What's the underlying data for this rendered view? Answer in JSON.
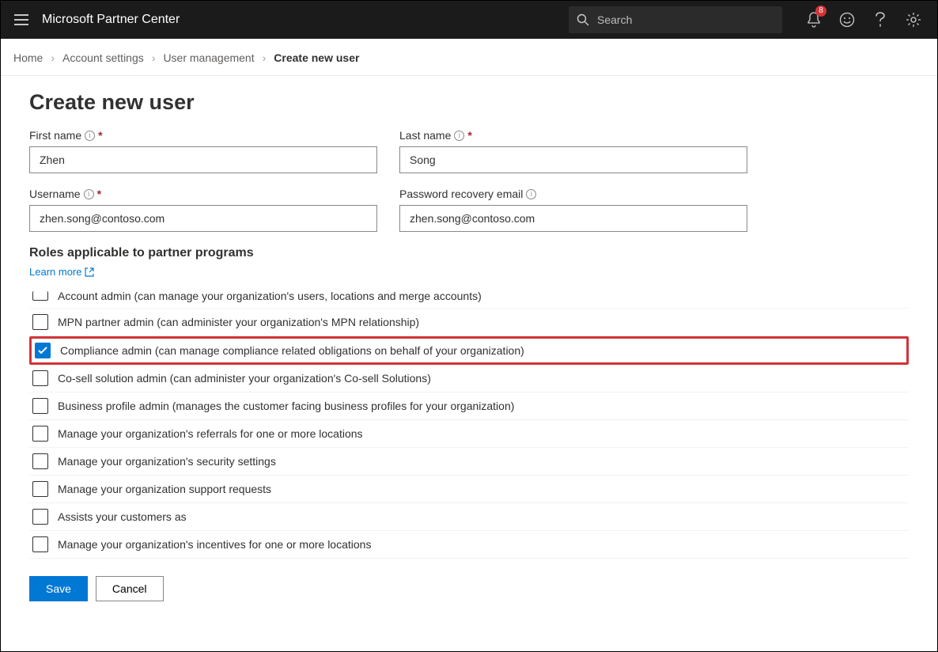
{
  "header": {
    "brand": "Microsoft Partner Center",
    "search_placeholder": "Search",
    "notification_count": "8"
  },
  "breadcrumb": {
    "items": [
      {
        "label": "Home"
      },
      {
        "label": "Account settings"
      },
      {
        "label": "User management"
      },
      {
        "label": "Create new user"
      }
    ]
  },
  "page": {
    "title": "Create new user",
    "fields": {
      "first_name_label": "First name",
      "first_name_value": "Zhen",
      "last_name_label": "Last name",
      "last_name_value": "Song",
      "username_label": "Username",
      "username_value": "zhen.song@contoso.com",
      "recovery_label": "Password recovery email",
      "recovery_value": "zhen.song@contoso.com"
    },
    "roles": {
      "section_title": "Roles applicable to partner programs",
      "learn_more": "Learn more",
      "items": [
        {
          "label": "Account admin (can manage your organization's users, locations and merge accounts)",
          "checked": false,
          "truncated": true
        },
        {
          "label": "MPN partner admin (can administer your organization's MPN relationship)",
          "checked": false
        },
        {
          "label": "Compliance admin (can manage compliance related obligations on behalf of your organization)",
          "checked": true,
          "highlight": true
        },
        {
          "label": "Co-sell solution admin (can administer your organization's Co-sell Solutions)",
          "checked": false
        },
        {
          "label": "Business profile admin (manages the customer facing business profiles for your organization)",
          "checked": false
        },
        {
          "label": "Manage your organization's referrals for one or more locations",
          "checked": false
        },
        {
          "label": "Manage your organization's security settings",
          "checked": false
        },
        {
          "label": "Manage your organization support requests",
          "checked": false
        },
        {
          "label": "Assists your customers as",
          "checked": false
        },
        {
          "label": "Manage your organization's incentives for one or more locations",
          "checked": false
        }
      ]
    },
    "buttons": {
      "save": "Save",
      "cancel": "Cancel"
    }
  }
}
